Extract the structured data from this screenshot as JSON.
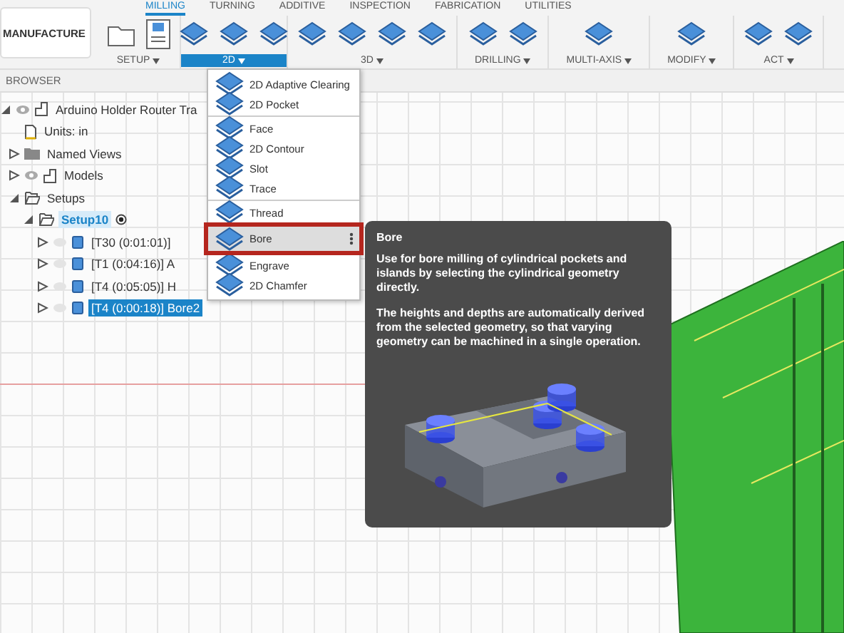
{
  "workspace": {
    "label": "MANUFACTURE"
  },
  "tabs": [
    {
      "label": "MILLING",
      "selected": true
    },
    {
      "label": "TURNING",
      "selected": false
    },
    {
      "label": "ADDITIVE",
      "selected": false
    },
    {
      "label": "INSPECTION",
      "selected": false
    },
    {
      "label": "FABRICATION",
      "selected": false
    },
    {
      "label": "UTILITIES",
      "selected": false
    }
  ],
  "groups": [
    {
      "label": "SETUP",
      "expanded": false
    },
    {
      "label": "2D",
      "expanded": true
    },
    {
      "label": "3D",
      "expanded": false
    },
    {
      "label": "DRILLING",
      "expanded": false
    },
    {
      "label": "MULTI-AXIS",
      "expanded": false
    },
    {
      "label": "MODIFY",
      "expanded": false
    },
    {
      "label": "ACT",
      "expanded": false
    }
  ],
  "browser": {
    "title": "BROWSER",
    "tree": [
      {
        "label": "Arduino Holder Router Tra",
        "kind": "component",
        "expanded": true,
        "selected": false,
        "children": [
          {
            "label": "Units: in",
            "kind": "units",
            "selected": false
          },
          {
            "label": "Named Views",
            "kind": "folder",
            "expanded": false,
            "selected": false
          },
          {
            "label": "Models",
            "kind": "component",
            "expanded": false,
            "selected": false
          },
          {
            "label": "Setups",
            "kind": "setups",
            "expanded": true,
            "selected": false,
            "children": [
              {
                "label": "Setup10",
                "kind": "setup",
                "expanded": true,
                "active": true,
                "selected": false,
                "children": [
                  {
                    "label": "[T30 (0:01:01)]",
                    "kind": "operation",
                    "expanded": false,
                    "selected": false
                  },
                  {
                    "label": "[T1 (0:04:16)] A",
                    "kind": "operation",
                    "expanded": false,
                    "selected": false
                  },
                  {
                    "label": "[T4 (0:05:05)] H",
                    "kind": "operation",
                    "expanded": false,
                    "selected": false
                  },
                  {
                    "label": "[T4 (0:00:18)] Bore2",
                    "kind": "operation",
                    "expanded": false,
                    "selected": true
                  }
                ]
              }
            ]
          }
        ]
      }
    ]
  },
  "menu": {
    "groups": [
      [
        {
          "label": "2D Adaptive Clearing",
          "selected": false
        },
        {
          "label": "2D Pocket",
          "selected": false
        }
      ],
      [
        {
          "label": "Face",
          "selected": false
        },
        {
          "label": "2D Contour",
          "selected": false
        },
        {
          "label": "Slot",
          "selected": false
        },
        {
          "label": "Trace",
          "selected": false
        }
      ],
      [
        {
          "label": "Thread",
          "selected": false
        },
        {
          "label": "Bore",
          "selected": true
        },
        {
          "label": "Engrave",
          "selected": false
        },
        {
          "label": "2D Chamfer",
          "selected": false
        }
      ]
    ]
  },
  "tooltip": {
    "title": "Bore",
    "paragraphs": [
      "Use for bore milling of cylindrical pockets and islands by selecting the cylindrical geometry directly.",
      "The heights and depths are automatically derived from the selected geometry, so that varying geometry can be machined in a single operation."
    ]
  }
}
